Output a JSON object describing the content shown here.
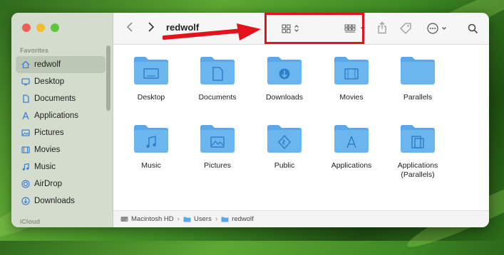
{
  "window": {
    "title": "redwolf"
  },
  "sidebar": {
    "sections": [
      {
        "label": "Favorites"
      },
      {
        "label": "iCloud"
      }
    ],
    "items": [
      {
        "label": "redwolf",
        "icon": "home-icon",
        "selected": true
      },
      {
        "label": "Desktop",
        "icon": "desktop-icon"
      },
      {
        "label": "Documents",
        "icon": "document-icon"
      },
      {
        "label": "Applications",
        "icon": "applications-icon"
      },
      {
        "label": "Pictures",
        "icon": "pictures-icon"
      },
      {
        "label": "Movies",
        "icon": "movies-icon"
      },
      {
        "label": "Music",
        "icon": "music-icon"
      },
      {
        "label": "AirDrop",
        "icon": "airdrop-icon"
      },
      {
        "label": "Downloads",
        "icon": "downloads-icon"
      }
    ]
  },
  "folders": [
    {
      "label": "Desktop",
      "icon": "desktop-folder-icon"
    },
    {
      "label": "Documents",
      "icon": "documents-folder-icon"
    },
    {
      "label": "Downloads",
      "icon": "downloads-folder-icon"
    },
    {
      "label": "Movies",
      "icon": "movies-folder-icon"
    },
    {
      "label": "Parallels",
      "icon": "folder-icon"
    },
    {
      "label": "Music",
      "icon": "music-folder-icon"
    },
    {
      "label": "Pictures",
      "icon": "pictures-folder-icon"
    },
    {
      "label": "Public",
      "icon": "public-folder-icon"
    },
    {
      "label": "Applications",
      "icon": "applications-folder-icon"
    },
    {
      "label": "Applications (Parallels)",
      "icon": "parallels-apps-folder-icon"
    }
  ],
  "pathbar": {
    "segments": [
      {
        "label": "Macintosh HD",
        "icon": "hard-drive-icon"
      },
      {
        "label": "Users",
        "icon": "folder-icon"
      },
      {
        "label": "redwolf",
        "icon": "folder-icon"
      }
    ]
  },
  "colors": {
    "folder": "#6cb6f0",
    "folder_tab": "#5aa8e8",
    "highlight": "#e3121b",
    "sidebar_bg": "#d4ddcd"
  }
}
